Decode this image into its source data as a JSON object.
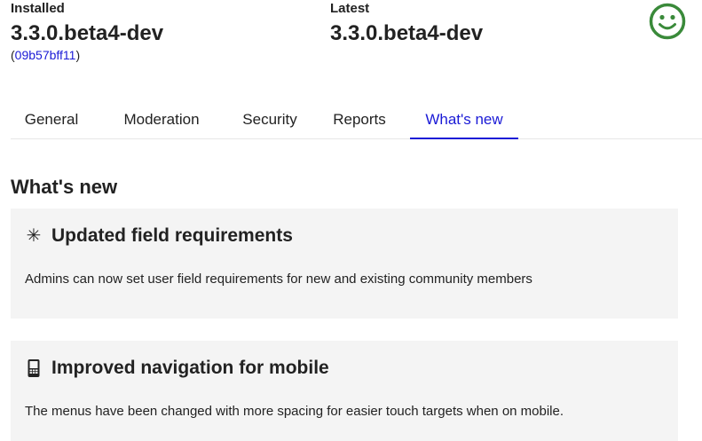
{
  "versions": {
    "installed_label": "Installed",
    "installed_value": "3.3.0.beta4-dev",
    "commit_open": "(",
    "commit_hash": "09b57bff11",
    "commit_close": ")",
    "latest_label": "Latest",
    "latest_value": "3.3.0.beta4-dev",
    "status_icon": "smiley-face-icon",
    "status_color": "#3a8a3a"
  },
  "tabs": [
    {
      "label": "General",
      "active": false
    },
    {
      "label": "Moderation",
      "active": false
    },
    {
      "label": "Security",
      "active": false
    },
    {
      "label": "Reports",
      "active": false
    },
    {
      "label": "What's new",
      "active": true
    }
  ],
  "whats_new": {
    "title": "What's new",
    "items": [
      {
        "icon": "asterisk-icon",
        "title": "Updated field requirements",
        "description": "Admins can now set user field requirements for new and existing community members"
      },
      {
        "icon": "mobile-phone-icon",
        "title": "Improved navigation for mobile",
        "description": "The menus have been changed with more spacing for easier touch targets when on mobile."
      }
    ]
  },
  "colors": {
    "accent": "#1a1ad6",
    "card_bg": "#f4f4f4",
    "text": "#222222"
  }
}
